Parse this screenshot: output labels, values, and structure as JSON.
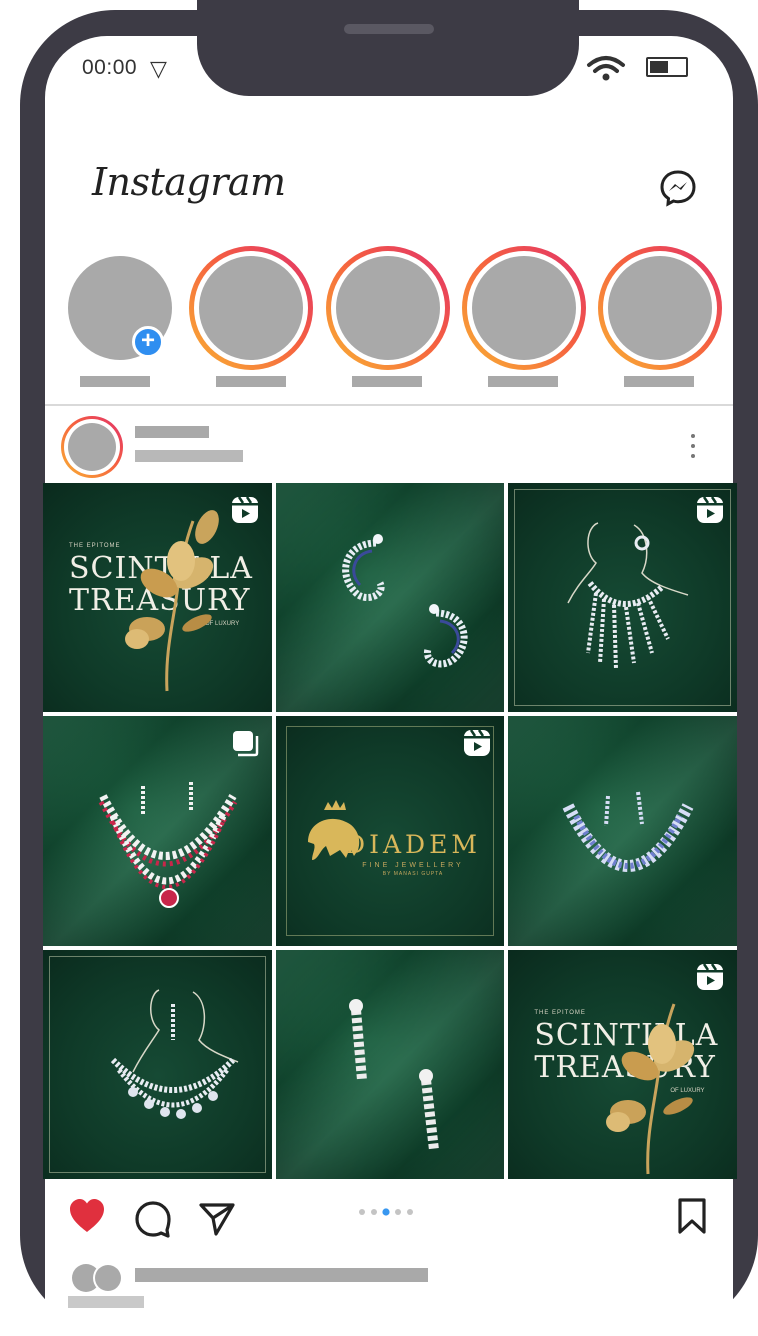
{
  "status_bar": {
    "time": "00:00",
    "signal_glyph": "▽",
    "wifi": "wifi-icon",
    "battery": "battery-icon"
  },
  "header": {
    "brand": "Instagram",
    "messenger_icon": "messenger-icon"
  },
  "stories": [
    {
      "own": true,
      "add_glyph": "+"
    },
    {
      "own": false
    },
    {
      "own": false
    },
    {
      "own": false
    },
    {
      "own": false
    }
  ],
  "grid": {
    "tiles": [
      {
        "kind": "text",
        "overlay": "reel-icon",
        "subtitle": "THE EPITOME",
        "lines": [
          "SCINTILLA",
          "TREASURY"
        ],
        "tagline": "OF LUXURY"
      },
      {
        "kind": "earrings-silk",
        "overlay": ""
      },
      {
        "kind": "necklace-sketch",
        "overlay": "reel-icon"
      },
      {
        "kind": "ruby-necklace",
        "overlay": "carousel-icon"
      },
      {
        "kind": "diadem-logo",
        "overlay": "reel-icon",
        "brand": "DIADEM",
        "subtitle": "FINE JEWELLERY",
        "byline": "BY MANASI GUPTA"
      },
      {
        "kind": "sapphire-necklace",
        "overlay": ""
      },
      {
        "kind": "drop-necklace-sketch",
        "overlay": ""
      },
      {
        "kind": "drop-earrings-silk",
        "overlay": ""
      },
      {
        "kind": "text",
        "overlay": "reel-icon",
        "subtitle": "THE EPITOME",
        "lines": [
          "SCINTILLA",
          "TREASURY"
        ],
        "tagline": "OF LUXURY"
      }
    ]
  },
  "colors": {
    "frame": "#3d3b45",
    "accent_blue": "#2f8ef0",
    "like_red": "#e0303e",
    "tile_green": "#0f3a28",
    "gold": "#d9b75a"
  },
  "actions": {
    "liked": true,
    "carousel_dots": 5,
    "carousel_active_index": 2
  }
}
